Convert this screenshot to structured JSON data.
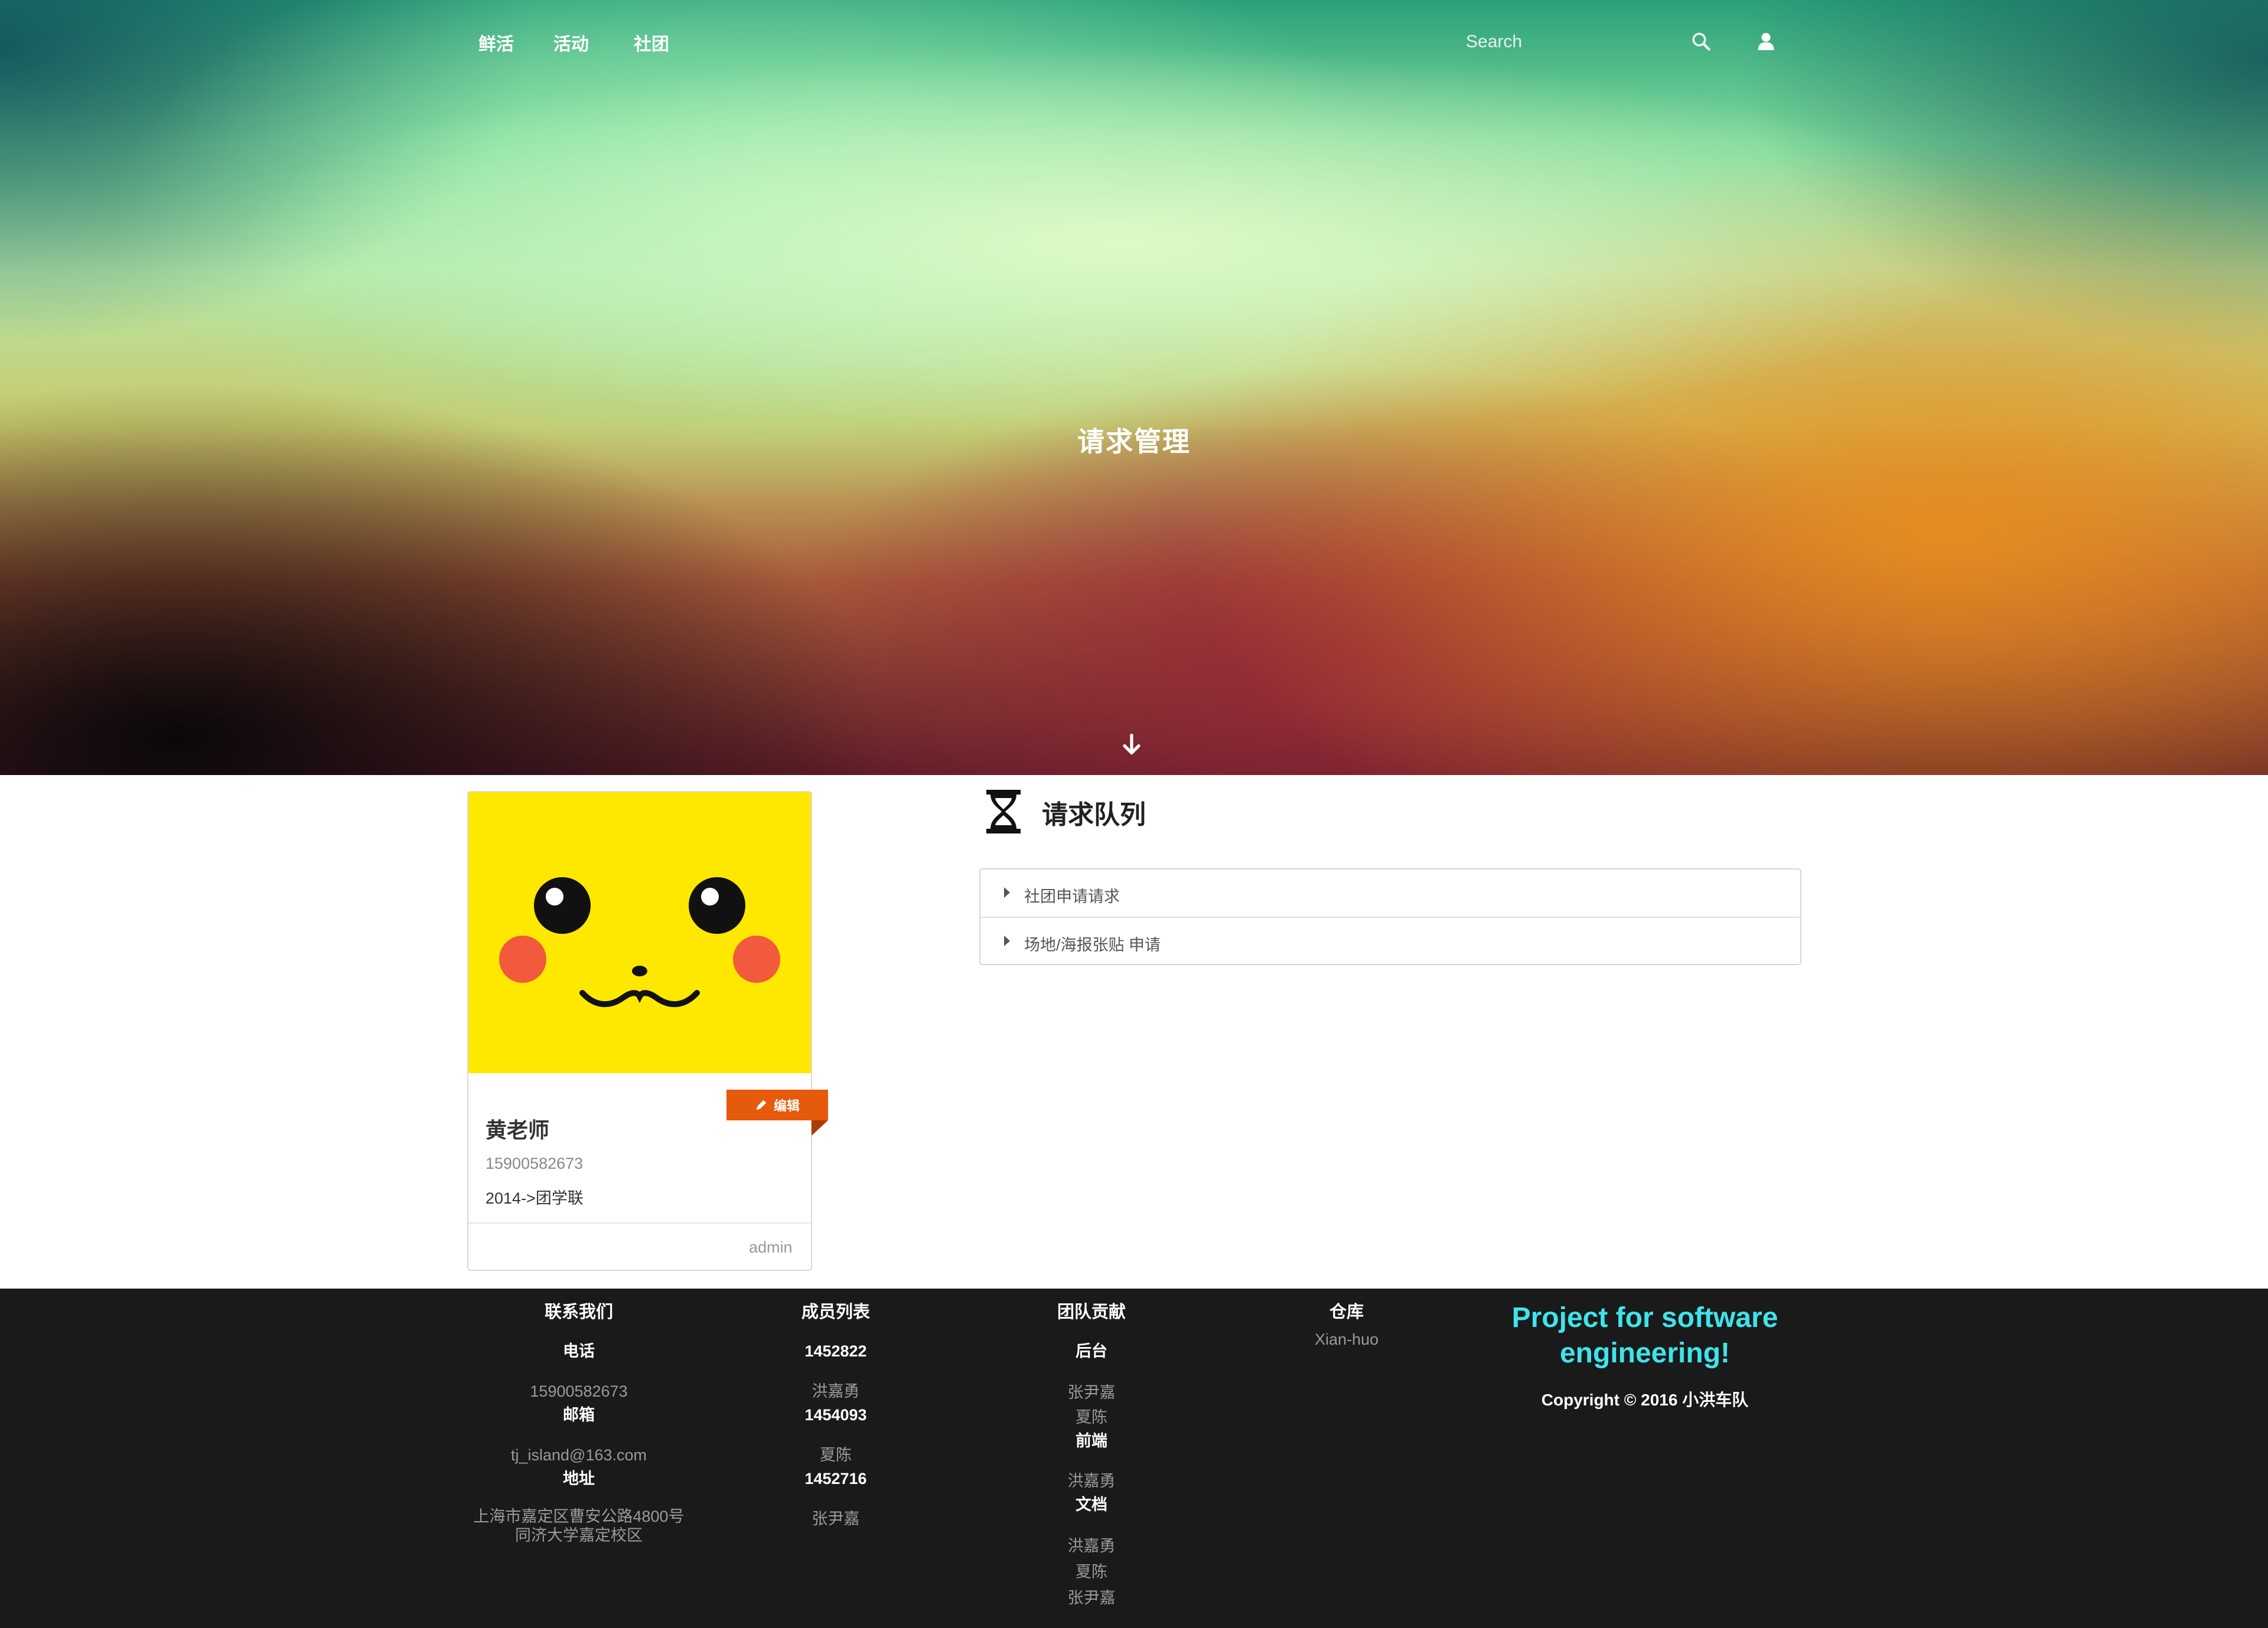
{
  "nav": {
    "links": [
      "鲜活",
      "活动",
      "社团"
    ],
    "search_placeholder": "Search",
    "icons": [
      "search-icon",
      "user-icon"
    ]
  },
  "hero": {
    "title": "请求管理",
    "scroll_icon": "arrow-down-icon"
  },
  "profile": {
    "name": "黄老师",
    "phone": "15900582673",
    "org": "2014->团学联",
    "role": "admin",
    "edit_label": "编辑",
    "edit_color": "#e65a0c"
  },
  "queue": {
    "title": "请求队列",
    "icon": "hourglass-icon",
    "items": [
      "社团申请请求",
      "场地/海报张贴 申请"
    ]
  },
  "footer": {
    "contact": {
      "title": "联系我们",
      "phone_label": "电话",
      "phone": "15900582673",
      "email_label": "邮箱",
      "email": "tj_island@163.com",
      "address_label": "地址",
      "address_line1": "上海市嘉定区曹安公路4800号",
      "address_line2": "同济大学嘉定校区"
    },
    "members": {
      "title": "成员列表",
      "list": [
        {
          "id": "1452822",
          "name": "洪嘉勇"
        },
        {
          "id": "1454093",
          "name": "夏陈"
        },
        {
          "id": "1452716",
          "name": "张尹嘉"
        }
      ]
    },
    "contribution": {
      "title": "团队贡献",
      "groups": [
        {
          "role": "后台",
          "people": [
            "张尹嘉",
            "夏陈"
          ]
        },
        {
          "role": "前端",
          "people": [
            "洪嘉勇"
          ]
        },
        {
          "role": "文档",
          "people": [
            "洪嘉勇",
            "夏陈",
            "张尹嘉"
          ]
        }
      ]
    },
    "repo": {
      "title": "仓库",
      "name": "Xian-huo"
    },
    "project": {
      "title": "Project for software engineering!",
      "copyright": "Copyright © 2016 小洪车队",
      "accent_color": "#3ee4ec"
    }
  }
}
